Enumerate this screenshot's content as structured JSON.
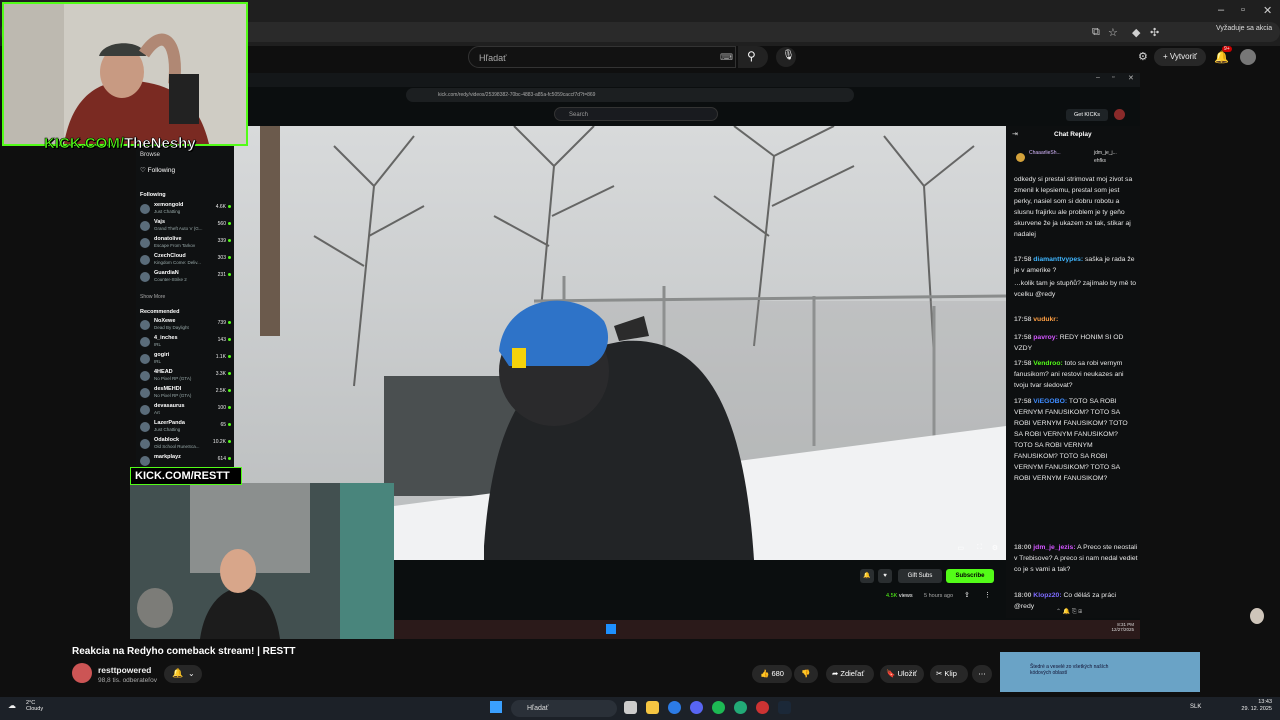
{
  "browser": {
    "yt_search_placeholder": "Hľadať",
    "create_label": "Vytvoriť",
    "notif_count": "9+",
    "promo_label": "Vyžaduje sa akcia"
  },
  "inner_browser": {
    "url": "kick.com/redy/videos/25398382-70bc-4883-a85a-fc5059caccf7d?t=869",
    "search_placeholder": "Search",
    "getkicks": "Get KICKs"
  },
  "cam1": {
    "label_prefix": "KICK.COM/",
    "label_name": "TheNeshy"
  },
  "cam2": {
    "label": "KICK.COM/RESTT"
  },
  "sidebar": {
    "browse": "Browse",
    "following": "Following",
    "section_following": "Following",
    "show_more": "Show More",
    "section_recommended": "Recommended",
    "items": [
      {
        "name": "xemongold",
        "game": "Just Chatting",
        "count": "4.6K"
      },
      {
        "name": "Vajs",
        "game": "Grand Theft Auto V (G...",
        "count": "560"
      },
      {
        "name": "donatolive",
        "game": "Escape From Tarkov",
        "count": "339"
      },
      {
        "name": "CzechCloud",
        "game": "Kingdom Come: Deliv...",
        "count": "303"
      },
      {
        "name": "GuardiaN",
        "game": "Counter-Strike 2",
        "count": "231"
      }
    ],
    "recommended": [
      {
        "name": "NoXewe",
        "game": "Dead By Daylight",
        "count": "739"
      },
      {
        "name": "4_inches",
        "game": "IRL",
        "count": "143"
      },
      {
        "name": "gogiri",
        "game": "IRL",
        "count": "1.1K"
      },
      {
        "name": "4HEAD",
        "game": "No Pixel RP (GTA)",
        "count": "3.3K"
      },
      {
        "name": "desMEHDI",
        "game": "No Pixel RP (GTA)",
        "count": "2.5K"
      },
      {
        "name": "devasaurus",
        "game": "Art",
        "count": "100"
      },
      {
        "name": "LazerPanda",
        "game": "Just Chatting",
        "count": "65"
      },
      {
        "name": "Odablock",
        "game": "Old School RuneSca...",
        "count": "10.2K"
      },
      {
        "name": "markplayz",
        "game": "",
        "count": "614"
      }
    ]
  },
  "chat": {
    "title": "Chat Replay",
    "top_users": [
      "ChaaarlieSh...",
      "jdm_je_j...",
      "ehfks"
    ],
    "lines": [
      {
        "time": "",
        "user": "",
        "text": "odkedy si prestal strimovat moj zivot sa zmenil k lepsiemu, prestal som jest perky, nasiel som si dobru robotu a slusnu frajirku ale problem je ty geňo skurvene že ja ukazem ze tak, stikar aj nadalej"
      },
      {
        "time": "17:58",
        "user": "diamanttvypes:",
        "text": "saška je rada že je v amerike ?"
      },
      {
        "time": "",
        "user": "",
        "text": "…kolik tam je stupňů? zajímalo by mě to vcelku @redy"
      },
      {
        "time": "17:58",
        "user": "vudukr:",
        "text": ""
      },
      {
        "time": "17:58",
        "user": "pavroy:",
        "text": "REDY HONIM SI OD VZDY"
      },
      {
        "time": "17:58",
        "user": "Vendroo:",
        "text": "toto sa robi vernym fanusikom? ani restovi neukazes ani tvoju tvar sledovat?"
      },
      {
        "time": "17:58",
        "user": "ViEGOBO:",
        "text": "TOTO SA ROBI VERNYM FANUSIKOM? TOTO SA ROBI VERNYM FANUSIKOM? TOTO SA ROBI VERNYM FANUSIKOM? TOTO SA ROBI VERNYM FANUSIKOM? TOTO SA ROBI VERNYM FANUSIKOM? TOTO SA ROBI VERNYM FANUSIKOM?"
      },
      {
        "time": "18:00",
        "user": "jdm_je_jezis:",
        "text": "A Preco ste neostali v Trebisove? A preco si nam nedal vediet co je s vami a tak?"
      },
      {
        "time": "18:00",
        "user": "Klopz20:",
        "text": "Co děláš za práci @redy"
      }
    ]
  },
  "under_video": {
    "gift_subs": "Gift Subs",
    "subscribe": "Subscribe",
    "views": "4.5K",
    "views_label": "views",
    "ago": "5 hours ago"
  },
  "yt": {
    "title": "Reakcia na Redyho comeback stream! | RESTT",
    "channel": "resttpowered",
    "subs": "98,8 tis. odberateľov",
    "likes": "680",
    "share": "Zdieľať",
    "save": "Uložiť",
    "clip": "Klip",
    "side_thumb_text": "Štedré a veselé zo všetkých naších kódových oblastí"
  },
  "taskbar": {
    "temp": "2°C",
    "weather": "Cloudy",
    "search": "Hľadať",
    "lang": "SLK",
    "time": "13:43",
    "date": "29. 12. 2025"
  },
  "inner_taskbar": {
    "time": "8:31 PM",
    "date": "12/27/2025"
  },
  "colors": {
    "kick_green": "#53fc18",
    "chat_bg": "#0d0f10",
    "yt_bg": "#0f0f0f"
  }
}
